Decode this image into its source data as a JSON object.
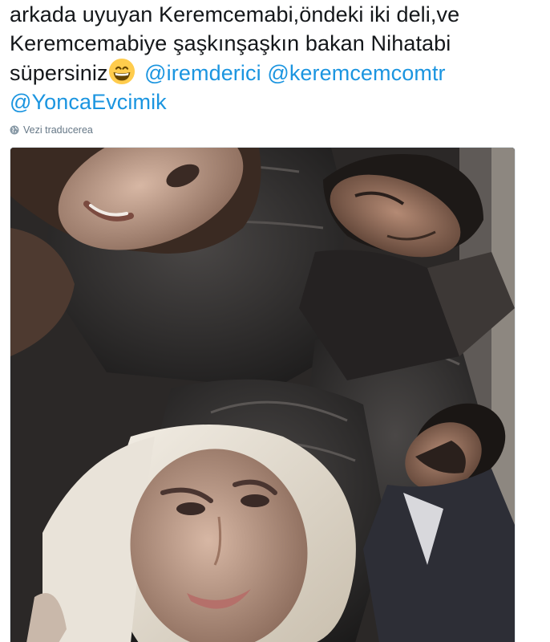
{
  "tweet": {
    "lines": [
      "arkada uyuyan Keremcemabi,öndeki iki deli,ve",
      "Keremcemabiye şaşkınşaşkın bakan Nihatabi",
      "süpersiniz"
    ],
    "mentions": [
      "@iremderici",
      "@keremcemcomtr",
      "@YoncaEvcimik"
    ],
    "emoji": "grinning-face-with-smiling-eyes"
  },
  "translate": {
    "label": "Vezi traducerea",
    "icon": "globe-icon"
  },
  "media": {
    "kind": "photo",
    "subject": "selfie-in-airplane-cabin"
  },
  "colors": {
    "text": "#14171a",
    "link": "#1b95e0",
    "muted": "#657786",
    "border": "#e1e8ed"
  }
}
